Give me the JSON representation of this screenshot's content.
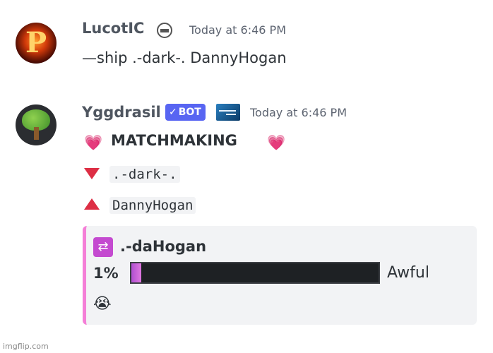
{
  "message1": {
    "username": "LucotIC",
    "timestamp": "Today at 6:46 PM",
    "content": "—ship .-dark-. DannyHogan",
    "avatar_letter": "P"
  },
  "message2": {
    "username": "Yggdrasil",
    "bot_badge": "BOT",
    "timestamp": "Today at 6:46 PM",
    "title": "MATCHMAKING",
    "user1": ".-dark-.",
    "user2": "DannyHogan",
    "embed": {
      "ship_name": ".-daHogan",
      "percent_label": "1%",
      "percent_value": 1,
      "rating": "Awful",
      "emoji": "😭",
      "accent_color": "#f47fd7"
    }
  },
  "watermark": "imgflip.com",
  "colors": {
    "bot_badge": "#5865f2",
    "heart": "#ff6fb1",
    "arrow_down": "#dd2e44",
    "arrow_up": "#dd2e44",
    "bar_bg": "#1e2124",
    "bar_fill": "#c35fd9"
  },
  "icons": {
    "badge1": "server-badge-icon",
    "badge2": "sign-badge-icon",
    "heart": "heart-icon",
    "shuffle": "shuffle-icon"
  }
}
